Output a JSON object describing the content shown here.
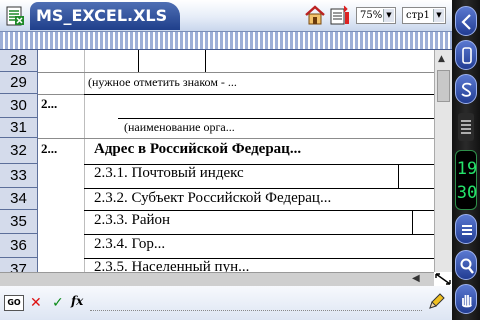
{
  "window": {
    "title": "MS_EXCEL.XLS",
    "zoom": "75%",
    "page": "стр1"
  },
  "sheet": {
    "rows": [
      {
        "num": "28",
        "cells": []
      },
      {
        "num": "29",
        "cells": [
          {
            "text": "(нужное отметить знаком - ..."
          }
        ]
      },
      {
        "num": "30",
        "cells": [
          {
            "text": "2..."
          }
        ]
      },
      {
        "num": "31",
        "cells": [
          {
            "text": "(наименование орга..."
          }
        ]
      },
      {
        "num": "32",
        "cells": [
          {
            "text": "2..."
          },
          {
            "text": "Адрес в Российской Федерац..."
          }
        ]
      },
      {
        "num": "33",
        "cells": [
          {
            "text": "2.3.1. Почтовый индекс"
          }
        ]
      },
      {
        "num": "34",
        "cells": [
          {
            "text": "2.3.2. Субъект Российской Федерац..."
          }
        ]
      },
      {
        "num": "35",
        "cells": [
          {
            "text": "2.3.3. Район"
          }
        ]
      },
      {
        "num": "36",
        "cells": [
          {
            "text": "2.3.4. Гор..."
          }
        ]
      },
      {
        "num": "37",
        "cells": [
          {
            "text": "2.3.5. Населенный пун..."
          }
        ]
      }
    ]
  },
  "formula_bar": {
    "go_label": "GO",
    "value": ""
  },
  "clock": {
    "hours": "19",
    "minutes": "30"
  },
  "colors": {
    "title_tab": "#2a4a9a",
    "column_header": "#9dafd7",
    "row_header": "#d4dbeb",
    "clock_digits": "#25e36b",
    "side_panel": "#1a1a1a"
  }
}
